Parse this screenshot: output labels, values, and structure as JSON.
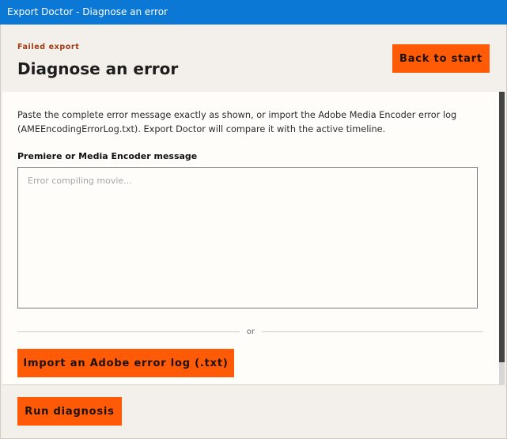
{
  "window": {
    "title": "Export Doctor - Diagnose an error"
  },
  "header": {
    "eyebrow": "Failed export",
    "title": "Diagnose an error",
    "back_label": "Back to start"
  },
  "main": {
    "intro": "Paste the complete error message exactly as shown, or import the Adobe Media Encoder error log (AMEEncodingErrorLog.txt). Export Doctor will compare it with the active timeline.",
    "message_label": "Premiere or Media Encoder message",
    "message_value": "",
    "message_placeholder": "Error compiling movie...",
    "divider_text": "or",
    "import_label": "Import an Adobe error log (.txt)"
  },
  "footer": {
    "run_label": "Run diagnosis"
  },
  "colors": {
    "titlebar": "#0a78d4",
    "accent_button": "#ff5a05",
    "eyebrow": "#a23a12",
    "background": "#f3f0eb",
    "panel": "#fefdfa"
  }
}
